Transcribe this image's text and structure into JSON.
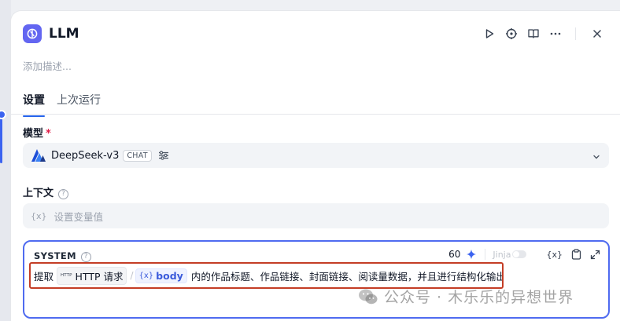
{
  "panel": {
    "title": "LLM",
    "description_placeholder": "添加描述...",
    "header_icons": [
      "play-icon",
      "crosshair-icon",
      "book-icon",
      "more-icon",
      "close-icon"
    ]
  },
  "tabs": [
    {
      "label": "设置",
      "active": true
    },
    {
      "label": "上次运行",
      "active": false
    }
  ],
  "model": {
    "label": "模型",
    "required_mark": "*",
    "name": "DeepSeek-v3",
    "badge": "CHAT"
  },
  "context": {
    "label": "上下文",
    "help": "?",
    "var_glyph": "{x}",
    "placeholder": "设置变量值"
  },
  "system": {
    "label": "SYSTEM",
    "help": "?",
    "token_count": "60",
    "jinja_label": "Jinja",
    "jinja_enabled": false,
    "var_tool": "{x}",
    "prompt": {
      "before": "提取",
      "http_icon": "HTTP",
      "node_name": "HTTP 请求",
      "separator": "/",
      "var_brace": "{x}",
      "var_name": "body",
      "after": "内的作品标题、作品链接、封面链接、阅读量数据，并且进行结构化输出。"
    }
  },
  "watermark": "公众号 · 木乐乐的异想世界",
  "colors": {
    "accent": "#3b63f0",
    "highlight_border": "#c43d25",
    "app_icon_bg": "#6366f1"
  }
}
